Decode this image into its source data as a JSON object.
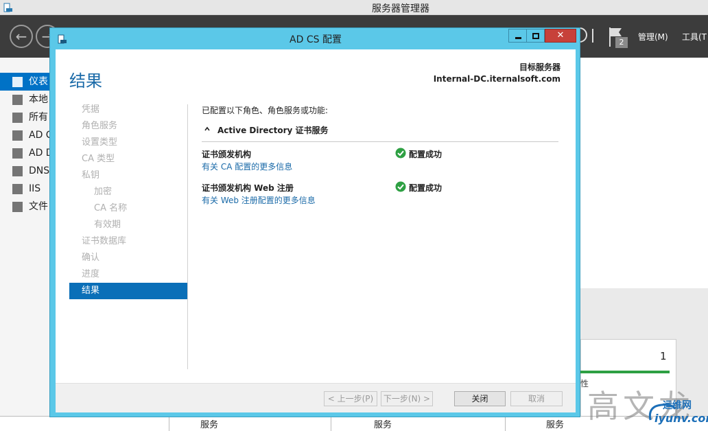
{
  "background_app": {
    "title": "服务器管理器",
    "menu": {
      "manage": "管理(M)",
      "tools": "工具(T"
    },
    "notification_count": "2",
    "sidebar": [
      {
        "label": "仪表",
        "active": true,
        "icon": "dashboard-icon"
      },
      {
        "label": "本地",
        "active": false,
        "icon": "local-server-icon"
      },
      {
        "label": "所有",
        "active": false,
        "icon": "all-servers-icon"
      },
      {
        "label": "AD C",
        "active": false,
        "icon": "adcs-icon"
      },
      {
        "label": "AD D",
        "active": false,
        "icon": "adds-icon"
      },
      {
        "label": "DNS",
        "active": false,
        "icon": "dns-icon"
      },
      {
        "label": "IIS",
        "active": false,
        "icon": "iis-icon"
      },
      {
        "label": "文件",
        "active": false,
        "icon": "file-services-icon"
      }
    ],
    "tile": {
      "count": "1",
      "text": "性"
    },
    "bottom_columns": [
      "服务",
      "服务",
      "服务"
    ],
    "watermark": "高文龙",
    "watermark_site": "iyunv.com",
    "watermark_logo_text": "运维网"
  },
  "dialog": {
    "title": "AD CS 配置",
    "page_title": "结果",
    "destination_label": "目标服务器",
    "destination_server": "Internal-DC.iternalsoft.com",
    "nav": [
      {
        "label": "凭据",
        "sub": false,
        "active": false
      },
      {
        "label": "角色服务",
        "sub": false,
        "active": false
      },
      {
        "label": "设置类型",
        "sub": false,
        "active": false
      },
      {
        "label": "CA 类型",
        "sub": false,
        "active": false
      },
      {
        "label": "私钥",
        "sub": false,
        "active": false
      },
      {
        "label": "加密",
        "sub": true,
        "active": false
      },
      {
        "label": "CA 名称",
        "sub": true,
        "active": false
      },
      {
        "label": "有效期",
        "sub": true,
        "active": false
      },
      {
        "label": "证书数据库",
        "sub": false,
        "active": false
      },
      {
        "label": "确认",
        "sub": false,
        "active": false
      },
      {
        "label": "进度",
        "sub": false,
        "active": false
      },
      {
        "label": "结果",
        "sub": false,
        "active": true
      }
    ],
    "intro": "已配置以下角色、角色服务或功能:",
    "section_header": "Active Directory 证书服务",
    "results": [
      {
        "title": "证书颁发机构",
        "link": "有关 CA 配置的更多信息",
        "status": "配置成功"
      },
      {
        "title": "证书颁发机构 Web 注册",
        "link": "有关 Web 注册配置的更多信息",
        "status": "配置成功"
      }
    ],
    "buttons": {
      "previous": "< 上一步(P)",
      "next": "下一步(N) >",
      "close": "关闭",
      "cancel": "取消"
    }
  }
}
